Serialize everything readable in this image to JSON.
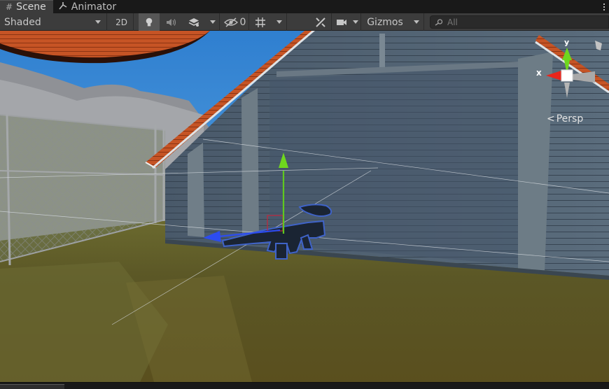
{
  "tabs": [
    {
      "label": "Scene",
      "icon": "grid-icon",
      "active": true
    },
    {
      "label": "Animator",
      "icon": "animator-icon",
      "active": false
    }
  ],
  "toolbar": {
    "draw_mode": "Shaded",
    "mode_2d": "2D",
    "hidden_count": "0",
    "gizmos_label": "Gizmos",
    "search_placeholder": "All"
  },
  "viewport": {
    "projection_label": "Persp",
    "axis_x_label": "x",
    "axis_y_label": "y",
    "axis_colors": {
      "x": "#e8251c",
      "y": "#6fd71e",
      "z": "#2c4cf0"
    }
  }
}
